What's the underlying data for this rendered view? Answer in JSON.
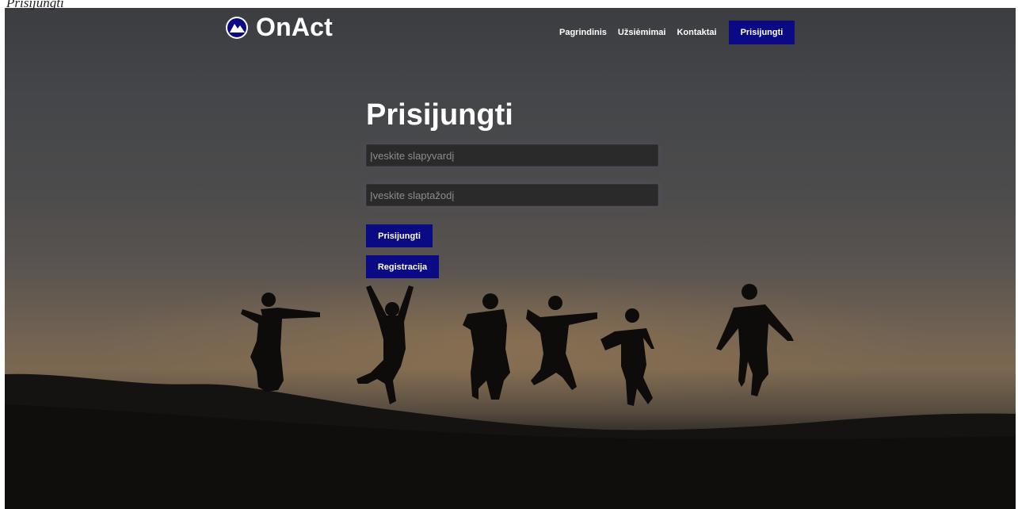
{
  "page_label": "Prisijungti",
  "header": {
    "logo_text": "OnAct",
    "nav": [
      {
        "label": "Pagrindinis"
      },
      {
        "label": "Užsiėmimai"
      },
      {
        "label": "Kontaktai"
      }
    ],
    "cta_label": "Prisijungti"
  },
  "login_form": {
    "title": "Prisijungti",
    "username_placeholder": "Įveskite slapyvardį",
    "password_placeholder": "Įveskite slaptažodį",
    "login_button": "Prisijungti",
    "register_button": "Registracija"
  },
  "colors": {
    "primary": "#0b0a85",
    "text": "#ffffff",
    "input_bg": "#2b2a2a"
  },
  "icons": {
    "logo": "mountain-circle-icon"
  }
}
